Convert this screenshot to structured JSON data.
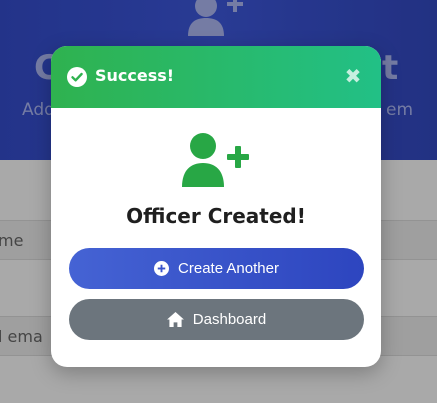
{
  "background": {
    "title": "C",
    "title_right": "t",
    "subtitle_left": "Add",
    "subtitle_right": "em",
    "field_1_label": "me",
    "field_2_label": "l ema"
  },
  "modal": {
    "header_title": "Success!",
    "close_glyph": "✖",
    "message": "Officer Created!",
    "primary_button_label": "Create Another",
    "secondary_button_label": "Dashboard"
  },
  "colors": {
    "success": "#2fb24f",
    "primary": "#3a54cc",
    "secondary": "#6c757d",
    "icon_green": "#28a745"
  },
  "icons": [
    "check-circle-icon",
    "close-icon",
    "user-plus-icon",
    "plus-circle-icon",
    "home-icon"
  ]
}
